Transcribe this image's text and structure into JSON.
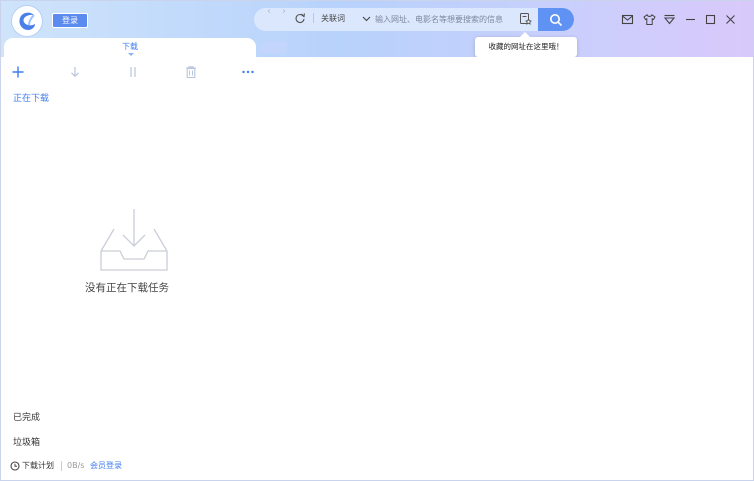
{
  "header": {
    "login_label": "登录",
    "search": {
      "keyword_type": "关联词",
      "placeholder": "输入网址、电影名等想要搜索的信息"
    },
    "tooltip": "收藏的网址在这里哦！"
  },
  "tabs": [
    {
      "label": "下载",
      "active": true
    }
  ],
  "sidebar": {
    "active_item": "正在下载",
    "completed": "已完成",
    "trash": "垃圾箱"
  },
  "main": {
    "empty_message": "没有正在下载任务"
  },
  "statusbar": {
    "plan_label": "下载计划",
    "speed": "0B/s",
    "vip_login": "会员登录"
  },
  "colors": {
    "accent": "#3f7df2",
    "search_button": "#5f92f3",
    "login_button": "#5c8bf0"
  },
  "icons": [
    "app-logo-icon",
    "back-icon",
    "forward-icon",
    "refresh-icon",
    "chevron-down-icon",
    "favorites-icon",
    "search-icon",
    "mail-icon",
    "shirt-icon",
    "menu-icon",
    "minimize-icon",
    "maximize-icon",
    "close-icon",
    "add-icon",
    "download-arrow-icon",
    "pause-icon",
    "delete-icon",
    "more-icon",
    "empty-tray-icon",
    "clock-icon"
  ]
}
